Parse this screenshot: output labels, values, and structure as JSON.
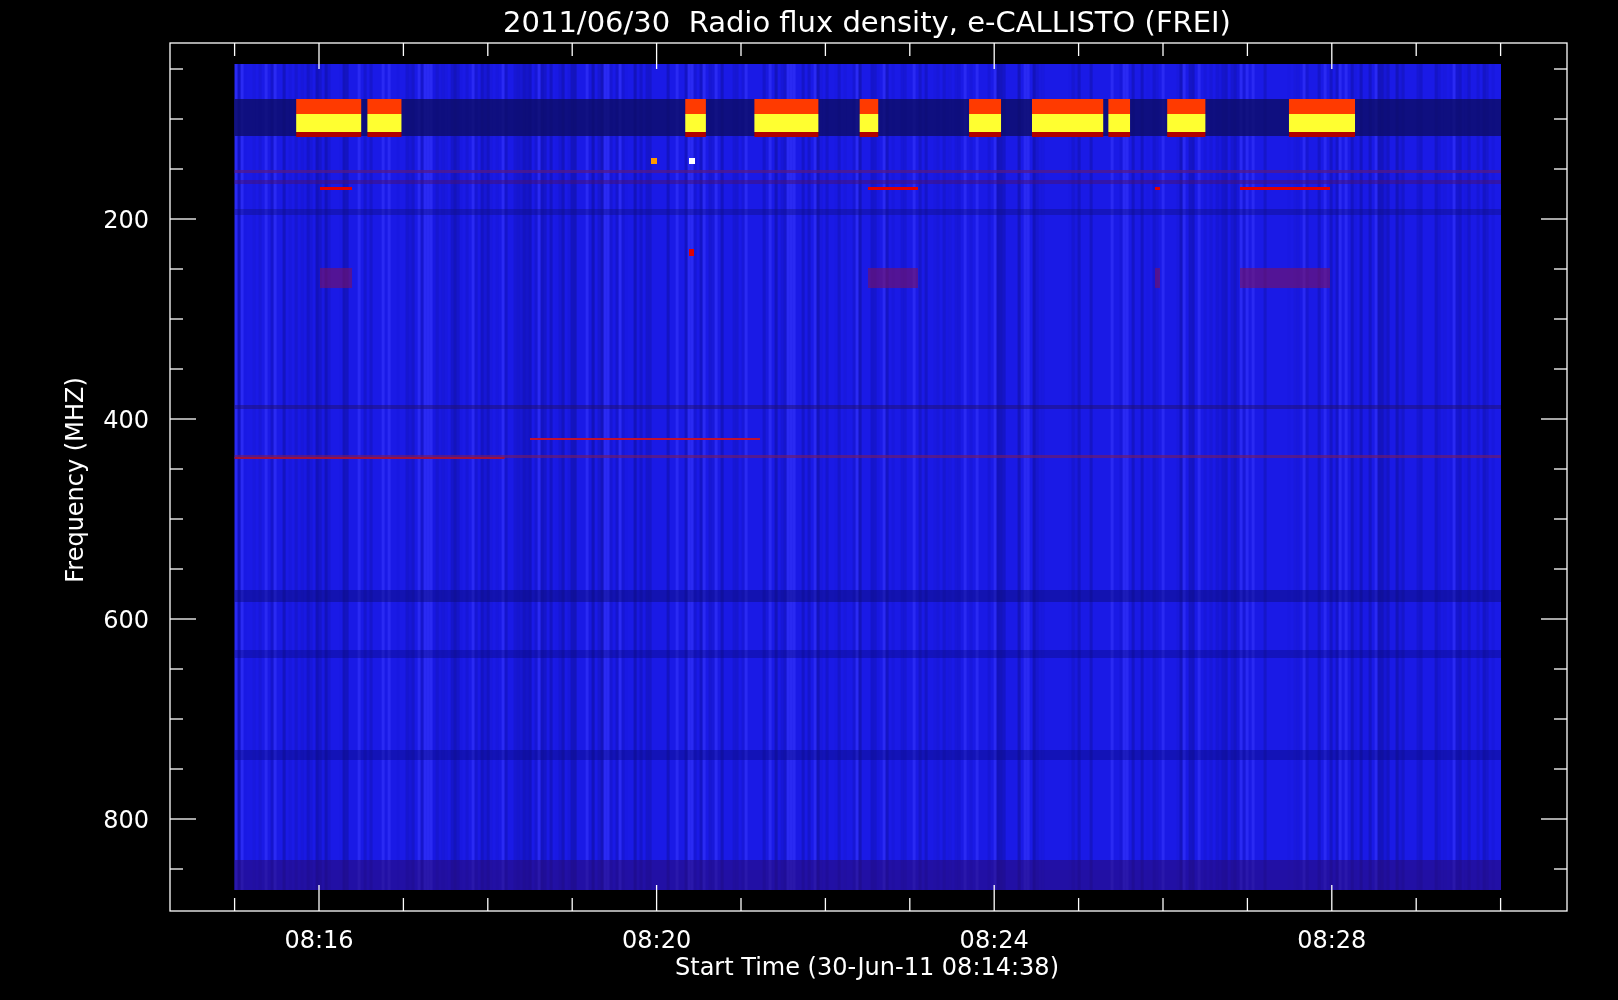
{
  "plot": {
    "title": "2011/06/30  Radio flux density, e-CALLISTO (FREI)",
    "x_axis": {
      "label": "Start Time (30-Jun-11 08:14:38)",
      "tick_labels": [
        "08:16",
        "08:20",
        "08:24",
        "08:28"
      ]
    },
    "y_axis": {
      "label": "Frequency (MHZ)",
      "tick_labels": [
        "200",
        "400",
        "600",
        "800"
      ]
    }
  }
}
